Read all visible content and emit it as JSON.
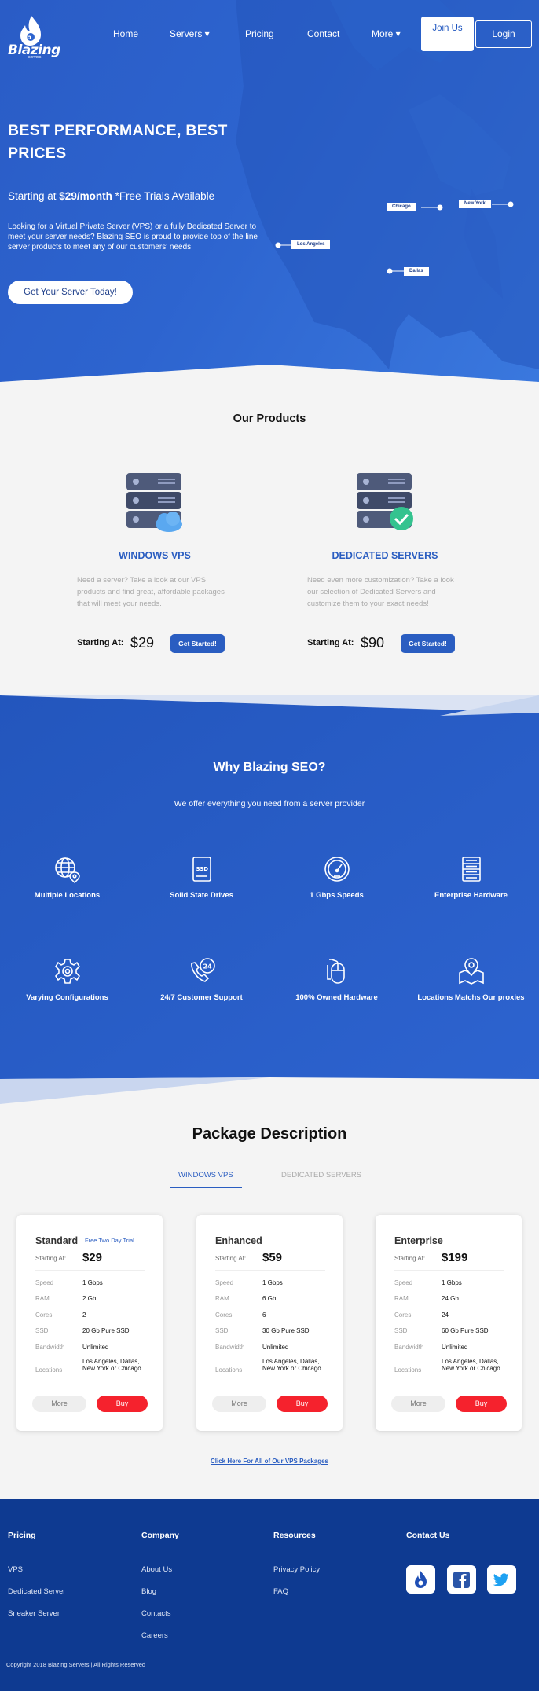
{
  "brand": {
    "name": "Blazing",
    "sub": "servers"
  },
  "nav": {
    "items": [
      {
        "label": "Home"
      },
      {
        "label": "Servers ▾"
      },
      {
        "label": "Pricing"
      },
      {
        "label": "Contact"
      },
      {
        "label": "More ▾"
      }
    ],
    "join_label": "Join Us",
    "login_label": "Login"
  },
  "hero": {
    "title": "BEST PERFORMANCE, BEST PRICES",
    "price_prefix": "Starting at ",
    "price_value": "$29/month",
    "price_suffix": " *Free Trials Available",
    "description": "Looking for a Virtual Private Server (VPS) or a fully Dedicated Server to meet your server needs? Blazing SEO is proud to provide top of the line server products to meet any of our customers' needs.",
    "cta": "Get Your Server Today!",
    "locations": [
      "Chicago",
      "New York",
      "Los Angeles",
      "Dallas"
    ]
  },
  "products": {
    "title": "Our Products",
    "items": [
      {
        "name": "WINDOWS VPS",
        "description": "Need a server? Take a look at our VPS products and find great, affordable packages that will meet your needs.",
        "starting_label": "Starting At:",
        "price": "$29",
        "button": "Get Started!"
      },
      {
        "name": "DEDICATED SERVERS",
        "description": "Need even more customization? Take a look our selection of Dedicated Servers and customize them to your exact needs!",
        "starting_label": "Starting At:",
        "price": "$90",
        "button": "Get Started!"
      }
    ]
  },
  "why": {
    "title": "Why Blazing SEO?",
    "subtitle": "We offer everything you need from a server provider",
    "features": [
      {
        "label": "Multiple Locations",
        "icon": "globe-pin-icon"
      },
      {
        "label": "Solid State Drives",
        "icon": "ssd-icon"
      },
      {
        "label": "1 Gbps Speeds",
        "icon": "speedometer-icon"
      },
      {
        "label": "Enterprise Hardware",
        "icon": "server-rack-icon"
      },
      {
        "label": "Varying Configurations",
        "icon": "gear-icon"
      },
      {
        "label": "24/7 Customer Support",
        "icon": "support-24-icon"
      },
      {
        "label": "100% Owned Hardware",
        "icon": "mouse-icon"
      },
      {
        "label": "Locations Matchs Our proxies",
        "icon": "map-pin-icon"
      }
    ]
  },
  "packages": {
    "title": "Package Description",
    "tabs": [
      "WINDOWS VPS",
      "DEDICATED SERVERS"
    ],
    "starting_label": "Starting At:",
    "row_labels": [
      "Speed",
      "RAM",
      "Cores",
      "SSD",
      "Bandwidth",
      "Locations"
    ],
    "more_label": "More",
    "buy_label": "Buy",
    "cards": [
      {
        "name": "Standard",
        "badge": "Free Two Day Trial",
        "price": "$29",
        "speed": "1 Gbps",
        "ram": "2 Gb",
        "cores": "2",
        "ssd": "20 Gb Pure SSD",
        "bandwidth": "Unlimited",
        "locations": "Los Angeles, Dallas, New York or Chicago"
      },
      {
        "name": "Enhanced",
        "badge": "",
        "price": "$59",
        "speed": "1 Gbps",
        "ram": "6 Gb",
        "cores": "6",
        "ssd": "30 Gb Pure SSD",
        "bandwidth": "Unlimited",
        "locations": "Los Angeles, Dallas, New York or Chicago"
      },
      {
        "name": "Enterprise",
        "badge": "",
        "price": "$199",
        "speed": "1 Gbps",
        "ram": "24 Gb",
        "cores": "24",
        "ssd": "60 Gb Pure SSD",
        "bandwidth": "Unlimited",
        "locations": "Los Angeles, Dallas, New York or Chicago"
      }
    ],
    "all_link": "Click Here For All of Our VPS Packages"
  },
  "footer": {
    "columns": [
      {
        "title": "Pricing",
        "links": [
          "VPS",
          "Dedicated Server",
          "Sneaker Server"
        ]
      },
      {
        "title": "Company",
        "links": [
          "About Us",
          "Blog",
          "Contacts",
          "Careers"
        ]
      },
      {
        "title": "Resources",
        "links": [
          "Privacy Policy",
          "FAQ"
        ]
      },
      {
        "title": "Contact Us",
        "links": []
      }
    ],
    "social": [
      "blazing-logo-icon",
      "facebook-icon",
      "twitter-icon"
    ],
    "copyright": "Copyright 2018 Blazing Servers | All Rights Reserved"
  },
  "colors": {
    "primary": "#2a5dc1",
    "hero_blue": "#2d64cf",
    "footer_blue": "#0e3a91",
    "buy_red": "#f5222d"
  }
}
